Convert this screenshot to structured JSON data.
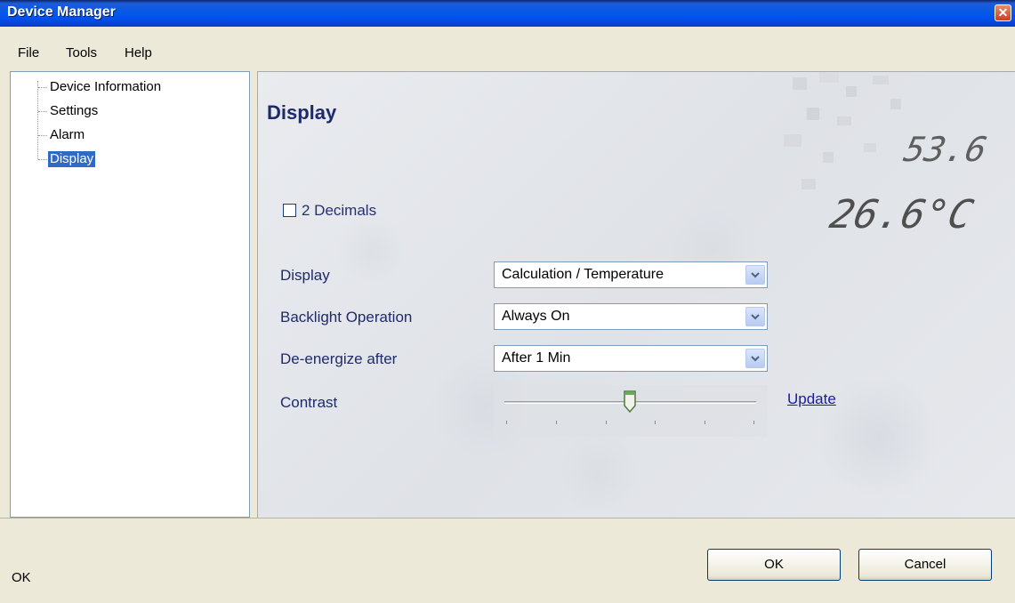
{
  "window": {
    "title": "Device Manager",
    "close_icon": "close-icon"
  },
  "menu": {
    "items": [
      "File",
      "Tools",
      "Help"
    ]
  },
  "tree": {
    "items": [
      {
        "label": "Device Information",
        "selected": false
      },
      {
        "label": "Settings",
        "selected": false
      },
      {
        "label": "Alarm",
        "selected": false
      },
      {
        "label": "Display",
        "selected": true
      }
    ]
  },
  "panel": {
    "heading": "Display",
    "decimals_checkbox": {
      "label": "2 Decimals",
      "checked": false
    },
    "display": {
      "label": "Display",
      "value": "Calculation / Temperature"
    },
    "backlight": {
      "label": "Backlight Operation",
      "value": "Always On"
    },
    "deenergize": {
      "label": "De-energize after",
      "value": "After 1 Min"
    },
    "contrast": {
      "label": "Contrast",
      "level": 0.5,
      "tick_count": 6
    },
    "update_link": "Update",
    "decorative_readout": [
      "53.6",
      "26.6°C"
    ]
  },
  "buttons": {
    "ok": "OK",
    "cancel": "Cancel"
  },
  "status": {
    "text": "OK"
  },
  "colors": {
    "title_bar": "#0a5ae6",
    "selection": "#316ac5",
    "heading": "#1f2a6b",
    "link": "#1a1aa6"
  }
}
